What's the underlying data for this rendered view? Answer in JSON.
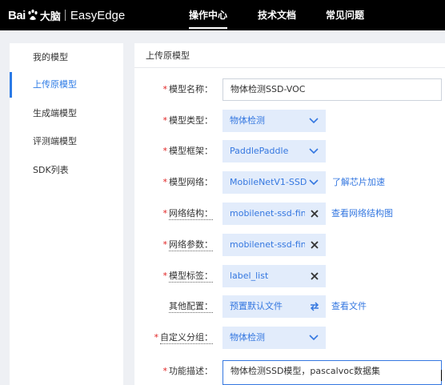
{
  "header": {
    "logo": {
      "brand_left": "Bai",
      "brand_right": "大脑",
      "product": "EasyEdge"
    },
    "nav": [
      {
        "label": "操作中心",
        "active": true
      },
      {
        "label": "技术文档",
        "active": false
      },
      {
        "label": "常见问题",
        "active": false
      }
    ]
  },
  "sidebar": {
    "items": [
      {
        "label": "我的模型",
        "active": false
      },
      {
        "label": "上传原模型",
        "active": true
      },
      {
        "label": "生成端模型",
        "active": false
      },
      {
        "label": "评测端模型",
        "active": false
      },
      {
        "label": "SDK列表",
        "active": false
      }
    ]
  },
  "main": {
    "title": "上传原模型",
    "form": {
      "model_name": {
        "required": "*",
        "label": "模型名称：",
        "value": "物体检测SSD-VOC"
      },
      "model_type": {
        "required": "*",
        "label": "模型类型：",
        "value": "物体检测"
      },
      "model_framework": {
        "required": "*",
        "label": "模型框架：",
        "value": "PaddlePaddle"
      },
      "model_network": {
        "required": "*",
        "label": "模型网络：",
        "value": "MobileNetV1-SSD",
        "link": "了解芯片加速"
      },
      "network_structure": {
        "required": "*",
        "label": "网络结构：",
        "value": "mobilenet-ssd-final-",
        "link": "查看网络结构图"
      },
      "network_params": {
        "required": "*",
        "label": "网络参数：",
        "value": "mobilenet-ssd-final-p"
      },
      "model_labels": {
        "required": "*",
        "label": "模型标签：",
        "value": "label_list"
      },
      "other_config": {
        "label": "其他配置：",
        "value": "预置默认文件",
        "link": "查看文件"
      },
      "custom_group": {
        "required": "*",
        "label": "自定义分组：",
        "value": "物体检测"
      },
      "description": {
        "required": "*",
        "label": "功能描述：",
        "value": "物体检测SSD模型，pascalvoc数据集"
      }
    }
  },
  "colors": {
    "accent": "#3477e0",
    "field_bg": "#e2ecfb",
    "required": "#e02020",
    "topbar": "#000000"
  }
}
